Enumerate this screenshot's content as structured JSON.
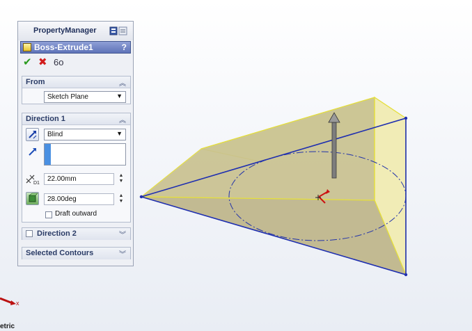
{
  "property_manager": {
    "title": "PropertyManager",
    "feature_name": "Boss-Extrude1",
    "help_label": "?",
    "actions": {
      "ok_symbol": "✔",
      "cancel_symbol": "✖",
      "preview_symbol": "6ο"
    },
    "from_group": {
      "title": "From",
      "start_condition": "Sketch Plane"
    },
    "direction1_group": {
      "title": "Direction 1",
      "end_condition": "Blind",
      "depth_badge": "D1",
      "depth": "22.00mm",
      "draft_angle": "28.00deg",
      "draft_outward_label": "Draft outward"
    },
    "direction2_group": {
      "title": "Direction 2"
    },
    "selected_contours_group": {
      "title": "Selected Contours"
    }
  },
  "viewport": {
    "triad_axis": "x",
    "view_label": "etric"
  },
  "colors": {
    "sketch_edge": "#1f2fb0",
    "preview_fill": "#fbf8c8",
    "preview_edge": "#e8e23a",
    "feature_bar": "#6b80c4"
  },
  "icons": [
    "help-icon",
    "ok-icon",
    "cancel-icon",
    "preview-icon",
    "reverse-direction-icon",
    "direction-arrow-icon",
    "depth-icon",
    "draft-icon",
    "chevron-up-icon",
    "chevron-down-icon"
  ]
}
